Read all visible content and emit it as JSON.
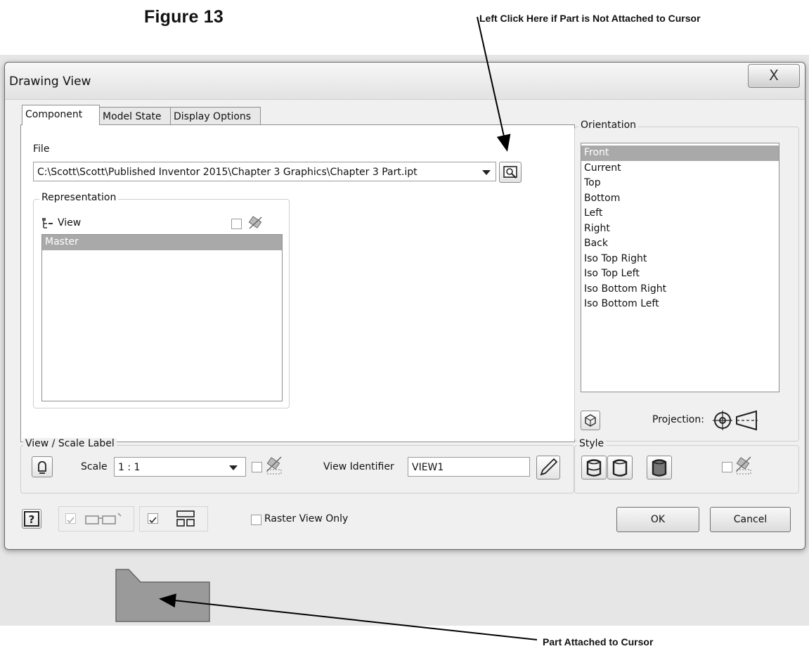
{
  "figure_title": "Figure 13",
  "callouts": {
    "top": "Left Click Here if Part is Not Attached to Cursor",
    "bottom": "Part Attached to Cursor"
  },
  "dialog": {
    "title": "Drawing View",
    "close_label": "X",
    "tabs": [
      "Component",
      "Model State",
      "Display Options"
    ],
    "file": {
      "label": "File",
      "value": "C:\\Scott\\Scott\\Published Inventor 2015\\Chapter 3 Graphics\\Chapter 3 Part.ipt"
    },
    "representation": {
      "label": "Representation",
      "view_label": "View",
      "items": [
        "Master"
      ]
    },
    "orientation": {
      "label": "Orientation",
      "items": [
        "Front",
        "Current",
        "Top",
        "Bottom",
        "Left",
        "Right",
        "Back",
        "Iso Top Right",
        "Iso Top Left",
        "Iso Bottom Right",
        "Iso Bottom Left"
      ],
      "selected": "Front",
      "projection_label": "Projection:"
    },
    "view_scale": {
      "label": "View / Scale Label",
      "scale_label": "Scale",
      "scale_value": "1 : 1",
      "identifier_label": "View Identifier",
      "identifier_value": "VIEW1"
    },
    "style_label": "Style",
    "raster_label": "Raster View Only",
    "ok_label": "OK",
    "cancel_label": "Cancel"
  }
}
